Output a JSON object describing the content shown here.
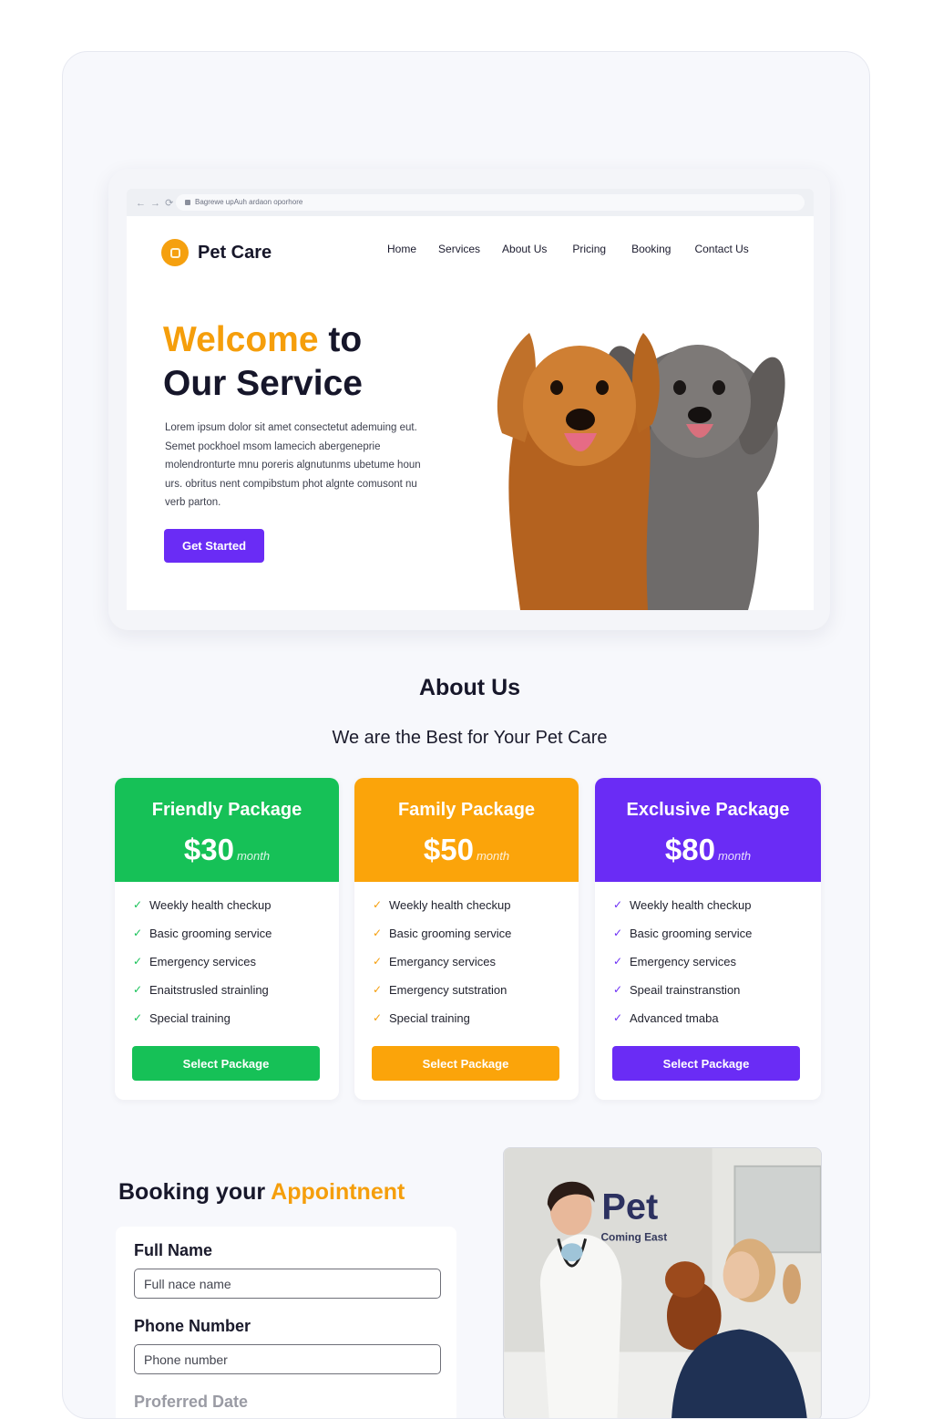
{
  "browser": {
    "nav_arrows": "← → ⟳",
    "url": "Bagrewe upAuh ardaon oporhore"
  },
  "site": {
    "brand": "Pet Care",
    "nav": [
      "Home",
      "Services",
      "About Us",
      "Pricing",
      "Booking",
      "Contact Us"
    ]
  },
  "hero": {
    "title_accent": "Welcome",
    "title_rest": " to",
    "title_line2": "Our Service",
    "text": "Lorem ipsum dolor sit amet consectetut ademuing eut. Semet pockhoel msom lamecich abergeneprie molendronturte mnu poreris algnutunms ubetume houn urs. obritus nent compibstum phot algnte comusont nu verb parton.",
    "cta": "Get Started"
  },
  "about": {
    "title": "About Us",
    "subtitle": "We are the Best for Your Pet Care"
  },
  "packages": [
    {
      "name": "Friendly Package",
      "price": "$30",
      "period": "month",
      "color": "#16c157",
      "features": [
        "Weekly health checkup",
        "Basic grooming service",
        "Emergency services",
        "Enaitstrusled  strainling",
        "Special training"
      ],
      "button": "Select Package"
    },
    {
      "name": "Family Package",
      "price": "$50",
      "period": "month",
      "color": "#fba40a",
      "features": [
        "Weekly health checkup",
        "Basic grooming service",
        "Emergancy services",
        "Emergency sutstration",
        "Special training"
      ],
      "button": "Select Package"
    },
    {
      "name": "Exclusive Package",
      "price": "$80",
      "period": "month",
      "color": "#6a2cf5",
      "features": [
        "Weekly health checkup",
        "Basic grooming service",
        "Emergency services",
        "Speail trainstranstion",
        "Advanced tmaba"
      ],
      "button": "Select Package"
    }
  ],
  "booking": {
    "title_start": "Booking your ",
    "title_accent": "Appointnent",
    "fields": [
      {
        "label": "Full Name",
        "placeholder": "Full nace name"
      },
      {
        "label": "Phone Number",
        "placeholder": "Phone number"
      },
      {
        "label": "Proferred Date"
      }
    ]
  },
  "clinic_sign": {
    "title": "Pet",
    "subtitle": "Coming East"
  }
}
